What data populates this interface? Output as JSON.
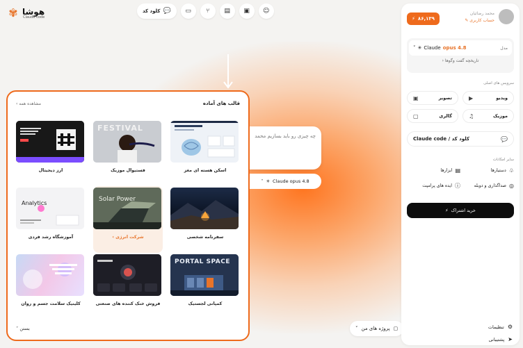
{
  "app": {
    "name": "هوشا",
    "subtitle": "Claude code"
  },
  "colors": {
    "accent": "#ee6a1c",
    "dark": "#0d0d0d"
  },
  "toolbar": {
    "pill_label": "کلود کد",
    "icons": [
      "smile-icon",
      "image-icon",
      "film-icon",
      "share-icon",
      "folder-icon",
      "code-chat-icon"
    ]
  },
  "templates": {
    "title": "قالب های آماده",
    "see_all": "مشاهده همه ›",
    "close": "بستن ˅",
    "items": [
      {
        "label": "اسکن هسته ای مغز"
      },
      {
        "label": "فستیوال موزیک",
        "thumb_text": "FESTIVAL"
      },
      {
        "label": "ارز دیجیتال"
      },
      {
        "label": "سفرنامه شخصی"
      },
      {
        "label": "شرکت انرژی ›",
        "thumb_text": "Solar Power"
      },
      {
        "label": "آموزشگاه رشد فردی",
        "thumb_text": "Analytics"
      },
      {
        "label": "کمپانی لجستیک",
        "thumb_text": "PORTAL SPACE"
      },
      {
        "label": "فروش خنک کننده های صنعتی"
      },
      {
        "label": "کلینیک سلامت جسم و روان"
      }
    ]
  },
  "chat": {
    "placeholder": "چه چیزی رو باید بسازیم محمد",
    "model_label": "Claude opus 4.8"
  },
  "projects": {
    "label": "پروژه های من"
  },
  "sidebar": {
    "user_name": "محمد رضائیان",
    "account_type": "حساب کاربری",
    "credit": "۸۶,۱۳۹",
    "model_field_label": "مدل",
    "model_name": "Claude",
    "model_version": "opus 4.8",
    "history": "تاریخچه گفت وگوها",
    "main_services_title": "سرویس های اصلی",
    "services": [
      {
        "label": "ویدیو",
        "icon": "video-icon"
      },
      {
        "label": "تصویر",
        "icon": "image-icon"
      },
      {
        "label": "موزیک",
        "icon": "music-icon"
      },
      {
        "label": "گالری",
        "icon": "gallery-icon"
      }
    ],
    "code_service": "کلود کد / Claude code",
    "other_title": "سایر امکانات",
    "others": [
      {
        "label": "دستیارها",
        "icon": "assistant-icon"
      },
      {
        "label": "ابزارها",
        "icon": "tools-icon"
      },
      {
        "label": "صداگذاری و دوبله",
        "icon": "voice-icon"
      },
      {
        "label": "ایده های پرامپت",
        "icon": "idea-icon"
      }
    ],
    "buy_button": "خرید اشتراک",
    "settings": "تنظیمات",
    "support": "پشتیبانی"
  }
}
